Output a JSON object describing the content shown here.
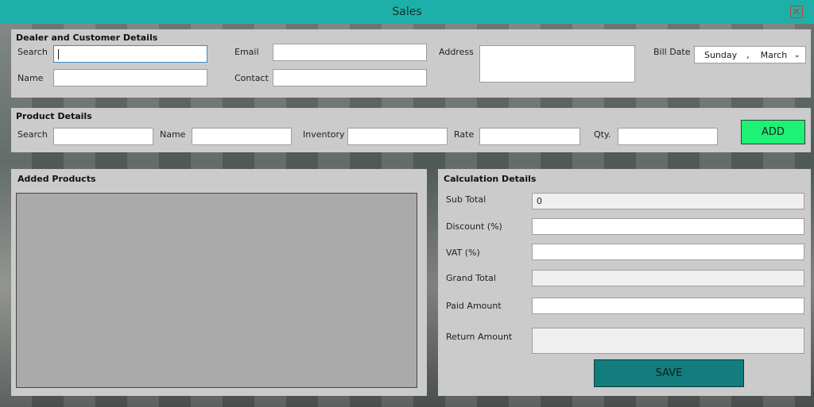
{
  "window": {
    "title": "Sales",
    "close_icon": "close-icon"
  },
  "dealer": {
    "title": "Dealer and Customer Details",
    "search_label": "Search",
    "search_value": "",
    "name_label": "Name",
    "name_value": "",
    "email_label": "Email",
    "email_value": "",
    "contact_label": "Contact",
    "contact_value": "",
    "address_label": "Address",
    "address_value": "",
    "bill_date_label": "Bill Date",
    "bill_date_day": "Sunday",
    "bill_date_sep": ",",
    "bill_date_month": "March"
  },
  "product": {
    "title": "Product Details",
    "search_label": "Search",
    "search_value": "",
    "name_label": "Name",
    "name_value": "",
    "inventory_label": "Inventory",
    "inventory_value": "",
    "rate_label": "Rate",
    "rate_value": "",
    "qty_label": "Qty.",
    "qty_value": "",
    "add_label": "ADD"
  },
  "added": {
    "title": "Added Products"
  },
  "calc": {
    "title": "Calculation Details",
    "subtotal_label": "Sub Total",
    "subtotal_value": "0",
    "discount_label": "Discount (%)",
    "discount_value": "",
    "vat_label": "VAT (%)",
    "vat_value": "",
    "grand_label": "Grand Total",
    "grand_value": "",
    "paid_label": "Paid Amount",
    "paid_value": "",
    "return_label": "Return Amount",
    "return_value": "",
    "save_label": "SAVE"
  }
}
